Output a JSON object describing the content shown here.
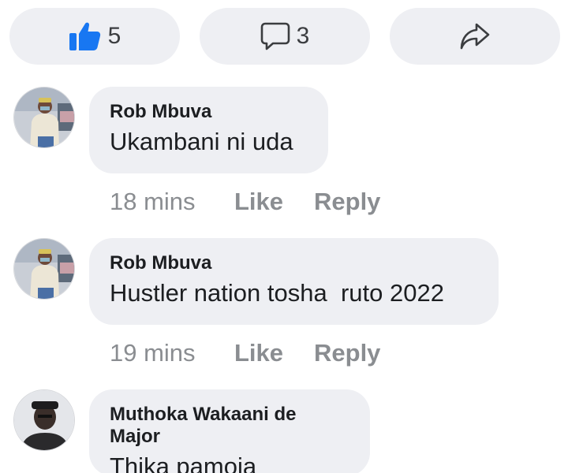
{
  "actions": {
    "like_count": "5",
    "comment_count": "3",
    "like_icon": "thumbs-up-icon",
    "comment_icon": "speech-bubble-icon",
    "share_icon": "share-arrow-icon"
  },
  "comments": [
    {
      "author": "Rob Mbuva",
      "text": "Ukambani ni uda",
      "time": "18 mins",
      "like_label": "Like",
      "reply_label": "Reply"
    },
    {
      "author": "Rob Mbuva",
      "text": "Hustler nation tosha  ruto 2022",
      "time": "19 mins",
      "like_label": "Like",
      "reply_label": "Reply"
    },
    {
      "author": "Muthoka Wakaani de Major",
      "text": "Thika pamoja"
    }
  ],
  "colors": {
    "pill_bg": "#eeeff3",
    "like_blue": "#1877f2",
    "meta_gray": "#8a8d91",
    "text_dark": "#1c1e21"
  }
}
